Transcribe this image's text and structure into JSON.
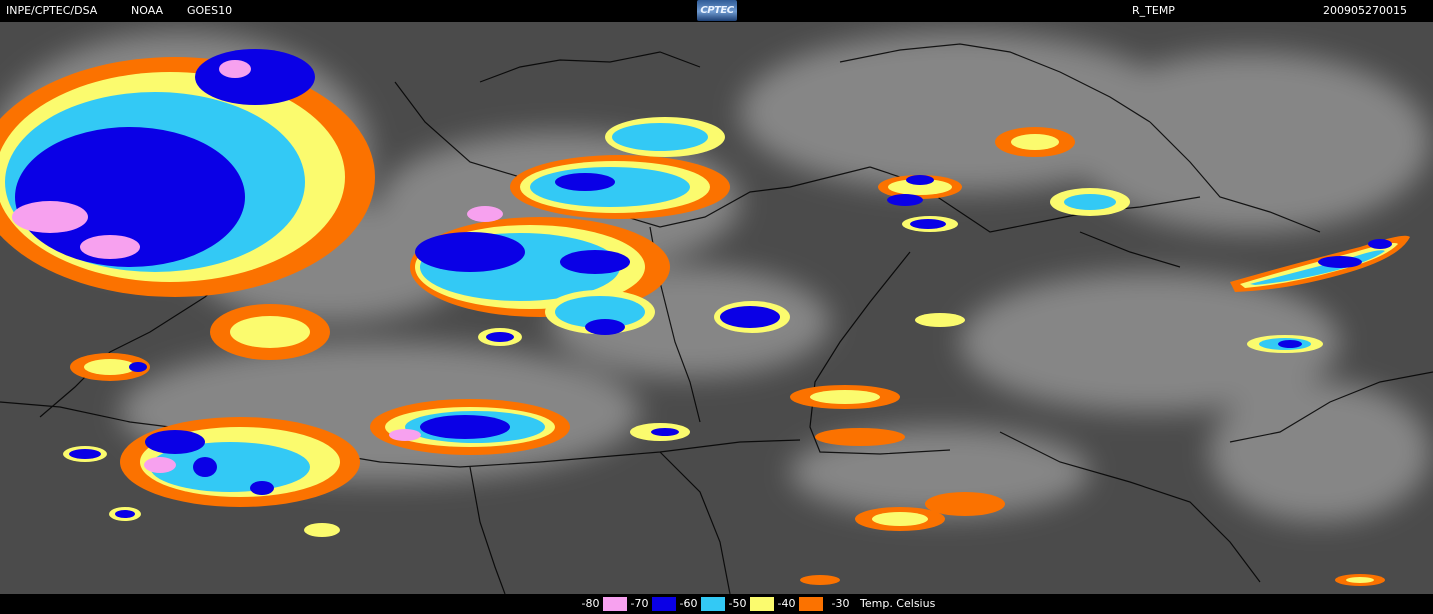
{
  "header": {
    "source": "INPE/CPTEC/DSA",
    "agency": "NOAA",
    "satellite": "GOES10",
    "logo_text": "CPTEC",
    "product": "R_TEMP",
    "timestamp": "200905270015"
  },
  "legend": {
    "classes": [
      {
        "label": "-80",
        "color": "#f7a1ef"
      },
      {
        "label": "-70",
        "color": "#0a00e6"
      },
      {
        "label": "-60",
        "color": "#33c9f5"
      },
      {
        "label": "-50",
        "color": "#fbfb6e"
      },
      {
        "label": "-40",
        "color": "#fb7200"
      },
      {
        "label": "-30",
        "color": ""
      }
    ],
    "unit_label": "Temp. Celsius"
  },
  "map": {
    "background_color": "#4b4b4b",
    "border_color": "#000000",
    "cloud_color": "#c8c8c8"
  }
}
